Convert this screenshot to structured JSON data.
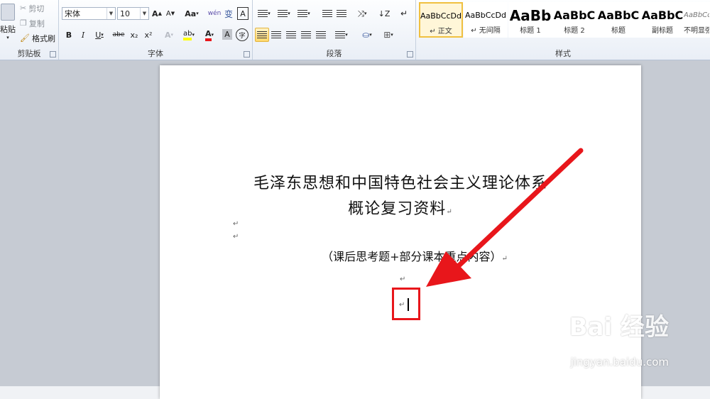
{
  "clipboard": {
    "paste_label": "粘贴",
    "cut_label": "剪切",
    "copy_label": "复制",
    "format_painter_label": "格式刷",
    "group_label": "剪贴板"
  },
  "font": {
    "name_value": "宋体",
    "size_value": "10",
    "grow_label": "A",
    "shrink_label": "A",
    "change_case_label": "Aa",
    "clear_format_label": "wén",
    "pinyin_label": "变",
    "border_char_label": "A",
    "bold_label": "B",
    "italic_label": "I",
    "underline_label": "U",
    "strike_label": "abe",
    "subscript_label": "x₂",
    "superscript_label": "x²",
    "text_effect_label": "A",
    "highlight_label": "ab",
    "font_color_label": "A",
    "char_shading_label": "A",
    "enclose_label": "字",
    "group_label": "字体"
  },
  "paragraph": {
    "group_label": "段落"
  },
  "styles": {
    "items": [
      {
        "sample": "AaBbCcDd",
        "name": "↵ 正文"
      },
      {
        "sample": "AaBbCcDd",
        "name": "↵ 无间隔"
      },
      {
        "sample": "AaBb",
        "name": "标题 1"
      },
      {
        "sample": "AaBbC",
        "name": "标题 2"
      },
      {
        "sample": "AaBbC",
        "name": "标题"
      },
      {
        "sample": "AaBbC",
        "name": "副标题"
      },
      {
        "sample": "AaBbCcDd",
        "name": "不明显强"
      }
    ],
    "group_label": "样式"
  },
  "document": {
    "title_line1": "毛泽东思想和中国特色社会主义理论体系",
    "title_line2": "概论复习资料",
    "subtitle": "（课后思考题+部分课本重点内容）",
    "para_mark": "↵"
  },
  "watermark": {
    "brand": "Bai  经验",
    "url": "jingyan.baidu.com"
  },
  "colors": {
    "highlight_box": "#e8161b",
    "arrow": "#e8161b",
    "active_style_border": "#f0c040"
  }
}
